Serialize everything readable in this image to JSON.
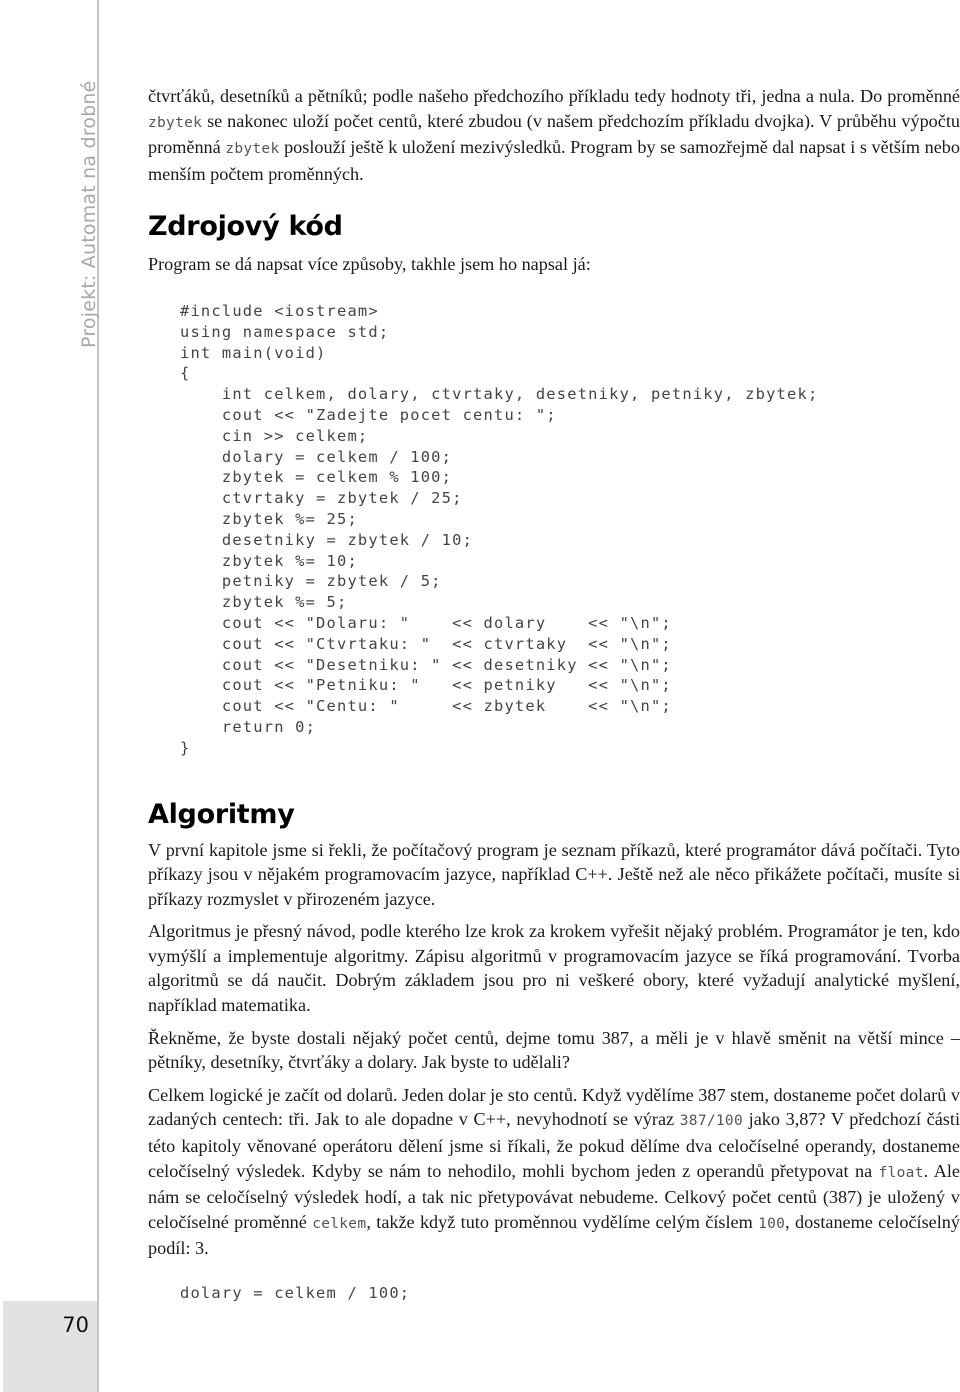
{
  "running_header": "Projekt: Automat na drobné",
  "page_number": "70",
  "top_paragraph": {
    "parts": [
      {
        "t": "čtvrťáků, desetníků a pětníků; podle našeho předchozího příkladu tedy hodnoty tři, jedna a nula. Do proměnné "
      },
      {
        "c": "zbytek"
      },
      {
        "t": " se nakonec uloží počet centů, které zbudou (v našem předchozím příkladu dvojka). V průběhu výpočtu proměnná "
      },
      {
        "c": "zbytek"
      },
      {
        "t": " poslouží ještě k uložení mezivýsledků. Program by se samozřejmě dal napsat i s větším nebo menším počtem proměnných."
      }
    ]
  },
  "source_section": {
    "heading": "Zdrojový kód",
    "intro": "Program se dá napsat více způsoby, takhle jsem ho napsal já:",
    "code_lines": [
      "#include <iostream>",
      "using namespace std;",
      "int main(void)",
      "{",
      "    int celkem, dolary, ctvrtaky, desetniky, petniky, zbytek;",
      "    cout << \"Zadejte pocet centu: \";",
      "    cin >> celkem;",
      "    dolary = celkem / 100;",
      "    zbytek = celkem % 100;",
      "    ctvrtaky = zbytek / 25;",
      "    zbytek %= 25;",
      "    desetniky = zbytek / 10;",
      "    zbytek %= 10;",
      "    petniky = zbytek / 5;",
      "    zbytek %= 5;",
      "    cout << \"Dolaru: \"    << dolary    << \"\\n\";",
      "    cout << \"Ctvrtaku: \"  << ctvrtaky  << \"\\n\";",
      "    cout << \"Desetniku: \" << desetniky << \"\\n\";",
      "    cout << \"Petniku: \"   << petniky   << \"\\n\";",
      "    cout << \"Centu: \"     << zbytek    << \"\\n\";",
      "    return 0;",
      "}"
    ]
  },
  "algorithms_section": {
    "heading": "Algoritmy",
    "paragraphs": [
      [
        {
          "t": "V první kapitole jsme si řekli, že počítačový program je seznam příkazů, které programátor dává počítači. Tyto příkazy jsou v nějakém programovacím jazyce, například C++. Ještě než ale něco přikážete počítači, musíte si příkazy rozmyslet v přirozeném jazyce."
        }
      ],
      [
        {
          "t": "Algoritmus je přesný návod, podle kterého lze krok za krokem vyřešit nějaký problém. Programátor je ten, kdo vymýšlí a implementuje algoritmy. Zápisu algoritmů v programovacím jazyce se říká programování. Tvorba algoritmů se dá naučit. Dobrým základem jsou pro ni veškeré obory, které vyžadují analytické myšlení, například matematika."
        }
      ],
      [
        {
          "t": "Řekněme, že byste dostali nějaký počet centů, dejme tomu 387, a měli je v hlavě směnit na větší mince – pětníky, desetníky, čtvrťáky a dolary. Jak byste to udělali?"
        }
      ],
      [
        {
          "t": "Celkem logické je začít od dolarů. Jeden dolar je sto centů. Když vydělíme 387 stem, dostaneme počet dolarů v zadaných centech: tři. Jak to ale dopadne v C++, nevyhodnotí se výraz "
        },
        {
          "c": "387/100"
        },
        {
          "t": " jako 3,87? V předchozí části této kapitoly věnované operátoru dělení jsme si říkali, že pokud dělíme dva celočíselné operandy, dostaneme celočíselný výsledek. Kdyby se nám to nehodilo, mohli bychom jeden z operandů přetypovat na "
        },
        {
          "c": "float"
        },
        {
          "t": ". Ale nám se celočíselný výsledek hodí, a tak nic přetypovávat nebudeme. Celkový počet centů (387) je uložený v celočíselné proměnné "
        },
        {
          "c": "celkem"
        },
        {
          "t": ", takže když tuto proměnnou vydělíme celým číslem "
        },
        {
          "c": "100"
        },
        {
          "t": ", dostaneme celočíselný podíl: 3."
        }
      ]
    ],
    "code_example": "dolary = celkem / 100;"
  }
}
